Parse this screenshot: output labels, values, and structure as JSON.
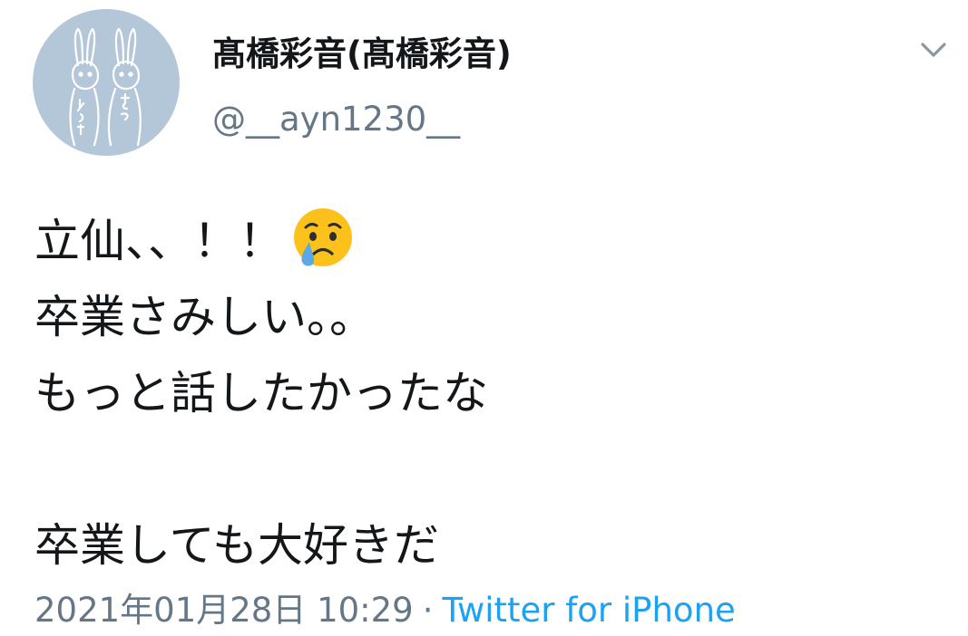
{
  "user": {
    "display_name": "髙橋彩音(髙橋彩音)",
    "handle": "@__ayn1230__",
    "avatar_icon": "rabbit-drawing-avatar",
    "avatar_color": "#b4c7d9"
  },
  "menu": {
    "icon": "chevron-down-icon"
  },
  "tweet": {
    "lines": [
      "立仙、、！！",
      "卒業さみしい。。",
      "もっと話したかったな",
      "",
      "卒業しても大好きだ"
    ],
    "emoji": "crying-face-emoji"
  },
  "meta": {
    "timestamp": "2021年01月28日 10:29",
    "separator": "·",
    "source": "Twitter for iPhone"
  },
  "colors": {
    "text": "#14171a",
    "secondary": "#657786",
    "link": "#1da1f2"
  }
}
